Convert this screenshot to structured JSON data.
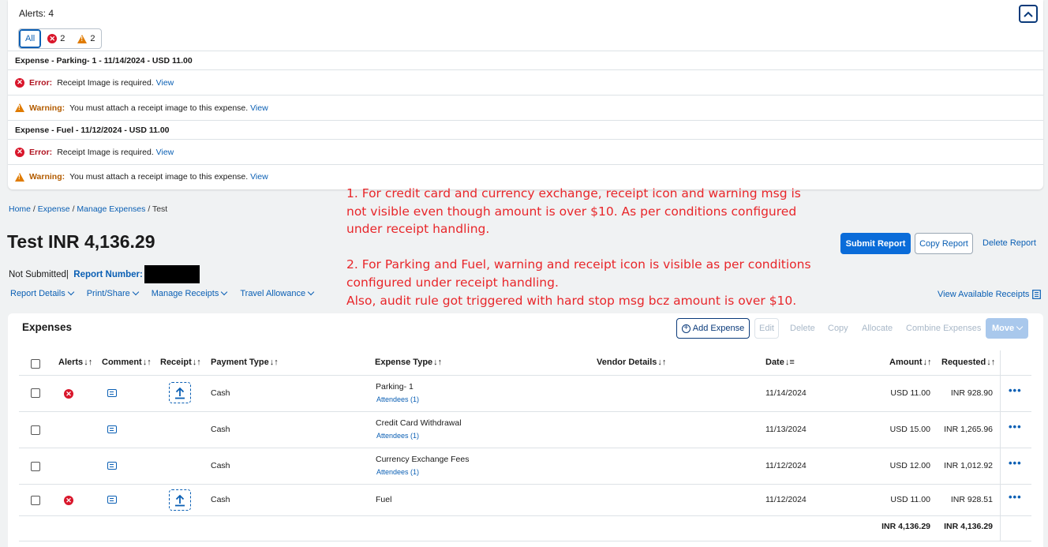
{
  "alerts": {
    "header": "Alerts: 4",
    "filters": {
      "all": "All",
      "error_count": "2",
      "warning_count": "2"
    },
    "groups": [
      {
        "title": "Expense - Parking- 1 - 11/14/2024 - USD 11.00",
        "error_label": "Error:",
        "error_text": "Receipt Image is required.",
        "error_link": "View",
        "warning_label": "Warning:",
        "warning_text": "You must attach a receipt image to this expense.",
        "warning_link": "View"
      },
      {
        "title": "Expense - Fuel - 11/12/2024 - USD 11.00",
        "error_label": "Error:",
        "error_text": "Receipt Image is required.",
        "error_link": "View",
        "warning_label": "Warning:",
        "warning_text": "You must attach a receipt image to this expense.",
        "warning_link": "View"
      }
    ]
  },
  "annotation": "1. For credit card and currency exchange, receipt icon and warning msg is\nnot visible even though amount is over $10. As per conditions configured\nunder receipt handling.\n\n2. For Parking and Fuel, warning and receipt icon is visible as per conditions\nconfigured under receipt handling.\nAlso, audit rule got triggered with hard stop msg bcz amount is over $10.",
  "breadcrumb": {
    "home": "Home",
    "expense": "Expense",
    "manage": "Manage Expenses",
    "current": "Test",
    "sep": " / "
  },
  "report": {
    "title": "Test INR 4,136.29",
    "status": "Not Submitted",
    "status_sep": " |",
    "report_number_label": "Report Number:",
    "submit": "Submit Report",
    "copy": "Copy Report",
    "delete": "Delete Report"
  },
  "menus": [
    "Report Details",
    "Print/Share",
    "Manage Receipts",
    "Travel Allowance"
  ],
  "view_receipts": "View Available Receipts",
  "expenses": {
    "title": "Expenses",
    "toolbar": {
      "add": "Add Expense",
      "edit": "Edit",
      "delete": "Delete",
      "copy": "Copy",
      "allocate": "Allocate",
      "combine": "Combine Expenses",
      "move": "Move"
    },
    "columns": {
      "alerts": "Alerts",
      "comment": "Comment",
      "receipt": "Receipt",
      "payment": "Payment Type",
      "type": "Expense Type",
      "vendor": "Vendor Details",
      "date": "Date",
      "amount": "Amount",
      "requested": "Requested"
    },
    "rows": [
      {
        "alert": true,
        "receipt": true,
        "payment": "Cash",
        "type": "Parking- 1",
        "attendees": "Attendees (1)",
        "date": "11/14/2024",
        "amount": "USD 11.00",
        "requested": "INR 928.90"
      },
      {
        "alert": false,
        "receipt": false,
        "payment": "Cash",
        "type": "Credit Card Withdrawal",
        "attendees": "Attendees (1)",
        "date": "11/13/2024",
        "amount": "USD 15.00",
        "requested": "INR 1,265.96"
      },
      {
        "alert": false,
        "receipt": false,
        "payment": "Cash",
        "type": "Currency Exchange Fees",
        "attendees": "Attendees (1)",
        "date": "11/12/2024",
        "amount": "USD 12.00",
        "requested": "INR 1,012.92"
      },
      {
        "alert": true,
        "receipt": true,
        "payment": "Cash",
        "type": "Fuel",
        "attendees": "",
        "date": "11/12/2024",
        "amount": "USD 11.00",
        "requested": "INR 928.51"
      }
    ],
    "totals": {
      "amount": "INR 4,136.29",
      "requested": "INR 4,136.29"
    }
  },
  "icons": {
    "error": "x-circle-icon",
    "warning": "warning-triangle-icon",
    "comment": "comment-icon",
    "receipt": "upload-receipt-icon",
    "more": "more-options-icon"
  },
  "colors": {
    "error": "#d9162b",
    "warning": "#e07b00",
    "link": "#0a5fb4",
    "primary": "#0a6cd9",
    "annotation": "#e8262a"
  }
}
